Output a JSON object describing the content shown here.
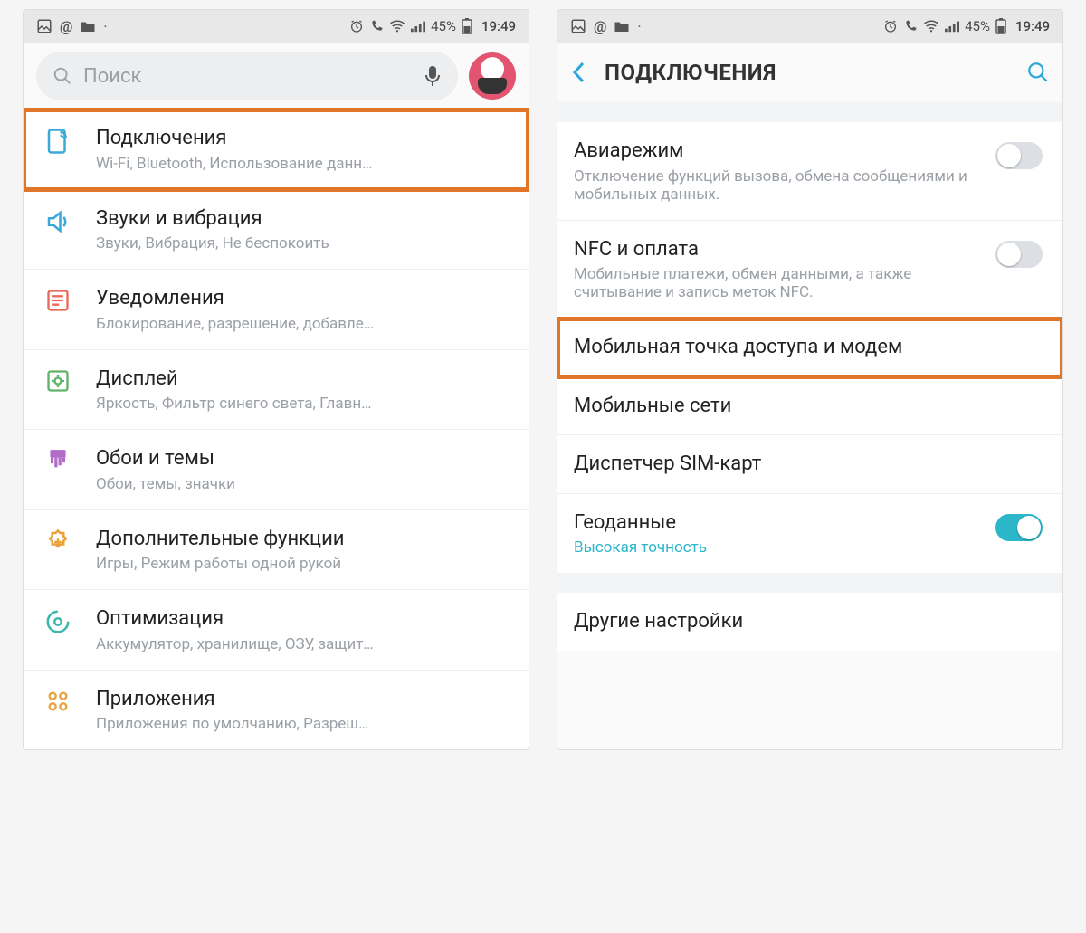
{
  "status": {
    "battery": "45%",
    "time": "19:49"
  },
  "left": {
    "search_placeholder": "Поиск",
    "items": [
      {
        "title": "Подключения",
        "sub": "Wi-Fi, Bluetooth, Использование данн…"
      },
      {
        "title": "Звуки и вибрация",
        "sub": "Звуки, Вибрация, Не беспокоить"
      },
      {
        "title": "Уведомления",
        "sub": "Блокирование, разрешение, добавле…"
      },
      {
        "title": "Дисплей",
        "sub": "Яркость, Фильтр синего света, Главн…"
      },
      {
        "title": "Обои и темы",
        "sub": "Обои, темы, значки"
      },
      {
        "title": "Дополнительные функции",
        "sub": "Игры, Режим работы одной рукой"
      },
      {
        "title": "Оптимизация",
        "sub": "Аккумулятор, хранилище, ОЗУ, защит…"
      },
      {
        "title": "Приложения",
        "sub": "Приложения по умолчанию, Разреш…"
      }
    ]
  },
  "right": {
    "header": "ПОДКЛЮЧЕНИЯ",
    "items": [
      {
        "title": "Авиарежим",
        "sub": "Отключение функций вызова, обмена сообщениями и мобильных данных.",
        "toggle": "off"
      },
      {
        "title": "NFC и оплата",
        "sub": "Мобильные платежи, обмен данными, а также считывание и запись меток NFC.",
        "toggle": "off"
      },
      {
        "title": "Мобильная точка доступа и модем"
      },
      {
        "title": "Мобильные сети"
      },
      {
        "title": "Диспетчер SIM-карт"
      },
      {
        "title": "Геоданные",
        "sub": "Высокая точность",
        "toggle": "on",
        "sublink": true
      },
      {
        "title": "Другие настройки"
      }
    ]
  }
}
